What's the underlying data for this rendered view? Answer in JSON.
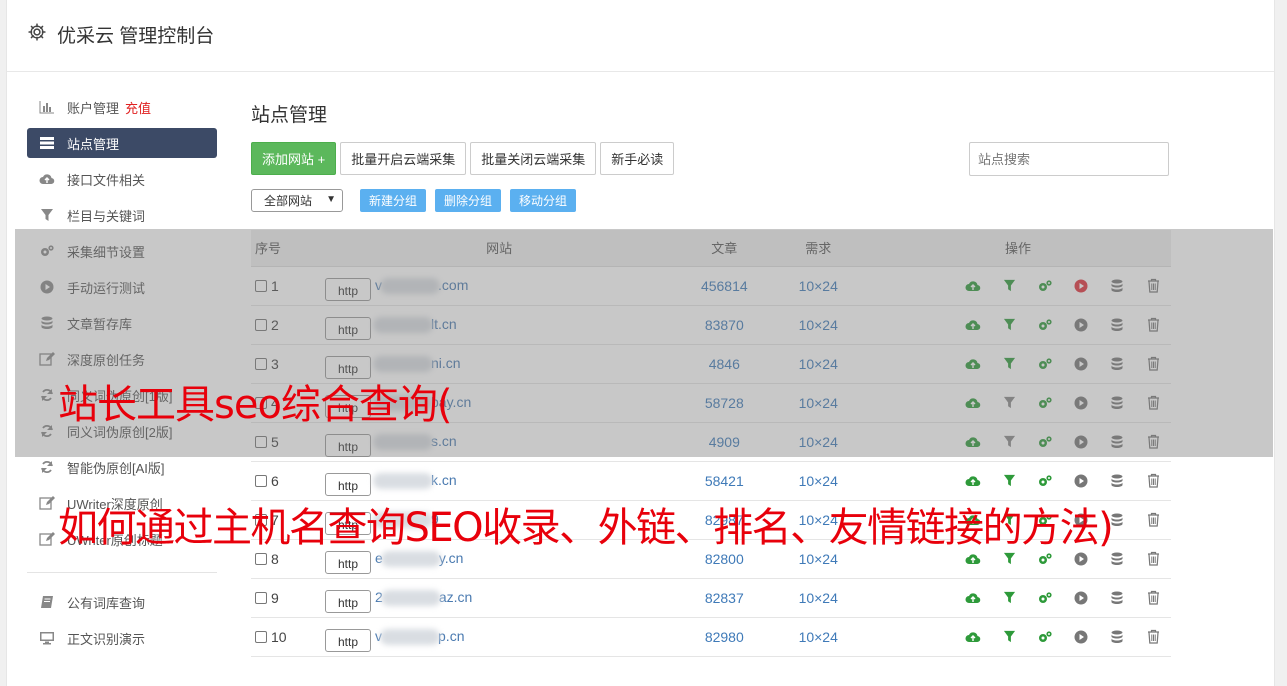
{
  "header": {
    "title": "优采云 管理控制台"
  },
  "sidebar": {
    "items": [
      {
        "label": "账户管理",
        "extra": "充值",
        "icon": "bar-chart-icon"
      },
      {
        "label": "站点管理",
        "icon": "server-icon",
        "active": true
      },
      {
        "label": "接口文件相关",
        "icon": "cloud-upload-icon"
      },
      {
        "label": "栏目与关键词",
        "icon": "filter-icon"
      },
      {
        "label": "采集细节设置",
        "icon": "cogs-icon"
      },
      {
        "label": "手动运行测试",
        "icon": "play-circle-icon"
      },
      {
        "label": "文章暂存库",
        "icon": "database-icon"
      },
      {
        "label": "深度原创任务",
        "icon": "edit-icon"
      },
      {
        "label": "同义词伪原创[1版]",
        "icon": "refresh-icon"
      },
      {
        "label": "同义词伪原创[2版]",
        "icon": "refresh-icon"
      },
      {
        "label": "智能伪原创[AI版]",
        "icon": "refresh-icon"
      },
      {
        "label": "UWriter深度原创",
        "icon": "edit-icon"
      },
      {
        "label": "UWriter原创标题",
        "icon": "edit-icon"
      }
    ],
    "items2": [
      {
        "label": "公有词库查询",
        "icon": "book-icon"
      },
      {
        "label": "正文识别演示",
        "icon": "monitor-icon"
      }
    ]
  },
  "main": {
    "title": "站点管理",
    "toolbar": {
      "add": "添加网站 +",
      "batch_open": "批量开启云端采集",
      "batch_close": "批量关闭云端采集",
      "newbie": "新手必读",
      "search_placeholder": "站点搜索"
    },
    "group_select": "全部网站",
    "group_buttons": [
      "新建分组",
      "删除分组",
      "移动分组"
    ],
    "table": {
      "headers": [
        "序号",
        "网站",
        "文章",
        "需求",
        "操作"
      ],
      "rows": [
        {
          "no": "1",
          "prefix": "v",
          "suffix": ".com",
          "articles": "456814",
          "req": "10×24"
        },
        {
          "no": "2",
          "prefix": "",
          "suffix": "lt.cn",
          "articles": "83870",
          "req": "10×24"
        },
        {
          "no": "3",
          "prefix": "",
          "suffix": "ni.cn",
          "articles": "4846",
          "req": "10×24"
        },
        {
          "no": "4",
          "prefix": "",
          "suffix": "bay.cn",
          "articles": "58728",
          "req": "10×24"
        },
        {
          "no": "5",
          "prefix": "",
          "suffix": "s.cn",
          "articles": "4909",
          "req": "10×24"
        },
        {
          "no": "6",
          "prefix": "",
          "suffix": "k.cn",
          "articles": "58421",
          "req": "10×24"
        },
        {
          "no": "7",
          "prefix": "",
          "suffix": "9",
          "articles": "82987",
          "req": "10×24"
        },
        {
          "no": "8",
          "prefix": "e",
          "suffix": "y.cn",
          "articles": "82800",
          "req": "10×24"
        },
        {
          "no": "9",
          "prefix": "2",
          "suffix": "az.cn",
          "articles": "82837",
          "req": "10×24"
        },
        {
          "no": "10",
          "prefix": "v",
          "suffix": "p.cn",
          "articles": "82980",
          "req": "10×24"
        }
      ],
      "http_label": "http"
    }
  },
  "overlay": {
    "line1": "站长工具seo综合查询(",
    "line2": "如何通过主机名查询SEO收录、外链、排名、友情链接的方法)"
  },
  "colors": {
    "accent_green": "#5cb85c",
    "active_nav": "#3c4a66",
    "link_blue": "#3f7ab8",
    "overlay_red": "#e8000b",
    "small_btn_blue": "#5bb0f0"
  }
}
